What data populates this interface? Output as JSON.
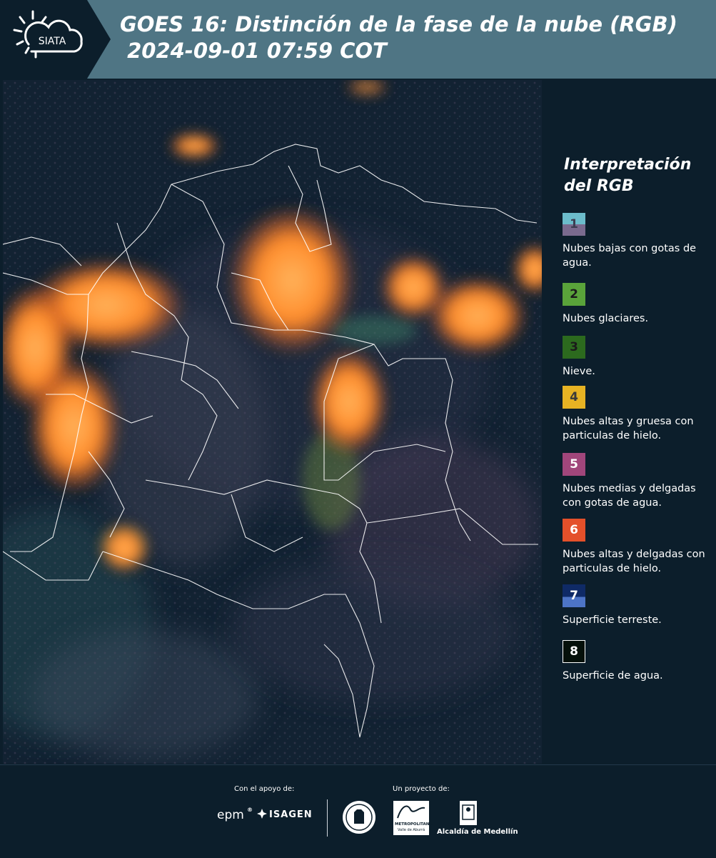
{
  "header": {
    "logo_text": "SIATA",
    "title_line1": "GOES 16: Distinción de la fase de la nube (RGB)",
    "title_line2": " 2024-09-01 07:59 COT"
  },
  "legend": {
    "title_line1": "Interpretación",
    "title_line2": "del RGB",
    "items": [
      {
        "num": "1",
        "label": "Nubes bajas con gotas de agua.",
        "color_top": "#6cbccb",
        "color_bottom": "#7a6a8e"
      },
      {
        "num": "2",
        "label": "Nubes glaciares.",
        "color": "#5aa33a"
      },
      {
        "num": "3",
        "label": "Nieve.",
        "color": "#2c6a1e"
      },
      {
        "num": "4",
        "label": "Nubes altas y gruesa con particulas de hielo.",
        "color": "#e7b323"
      },
      {
        "num": "5",
        "label": "Nubes medias y delgadas con gotas de agua.",
        "color": "#a1467b"
      },
      {
        "num": "6",
        "label": "Nubes altas y delgadas con particulas de hielo.",
        "color": "#e4502a"
      },
      {
        "num": "7",
        "label": "Superficie terreste.",
        "color_top": "#0f2a66",
        "color_bottom": "#4d74c6"
      },
      {
        "num": "8",
        "label": "Superficie de agua.",
        "color": "#05100a"
      }
    ]
  },
  "footer": {
    "support_label": "Con el apoyo de:",
    "project_label": "Un proyecto de:",
    "epm": "epm",
    "isagen": "ISAGEN",
    "area_line1": "METROPOLITANA",
    "area_line2": "Valle de Aburrá",
    "alcaldia": "Alcaldía de Medellín"
  }
}
